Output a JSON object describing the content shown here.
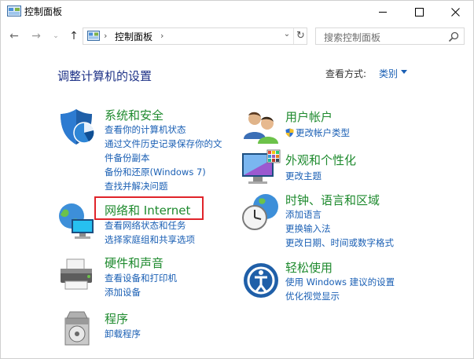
{
  "window": {
    "title": "控制面板"
  },
  "nav": {
    "back": "←",
    "forward": "→",
    "recent": "⌄",
    "up": "↑",
    "address": "控制面板",
    "address_sep": "›",
    "dropdown": "⌄",
    "refresh": "↻"
  },
  "search": {
    "placeholder": "搜索控制面板"
  },
  "header": {
    "title": "调整计算机的设置",
    "view_by_label": "查看方式:",
    "view_by_value": "类别"
  },
  "categories": {
    "system": {
      "title": "系统和安全",
      "links": [
        "查看你的计算机状态",
        "通过文件历史记录保存你的文",
        "件备份副本",
        "备份和还原(Windows 7)",
        "查找并解决问题"
      ]
    },
    "network": {
      "title": "网络和 Internet",
      "links": [
        "查看网络状态和任务",
        "选择家庭组和共享选项"
      ]
    },
    "hardware": {
      "title": "硬件和声音",
      "links": [
        "查看设备和打印机",
        "添加设备"
      ]
    },
    "programs": {
      "title": "程序",
      "links": [
        "卸载程序"
      ]
    },
    "users": {
      "title": "用户帐户",
      "links": [
        "更改帐户类型"
      ]
    },
    "appearance": {
      "title": "外观和个性化",
      "links": [
        "更改主题"
      ]
    },
    "clock": {
      "title": "时钟、语言和区域",
      "links": [
        "添加语言",
        "更换输入法",
        "更改日期、时间或数字格式"
      ]
    },
    "ease": {
      "title": "轻松使用",
      "links": [
        "使用 Windows 建议的设置",
        "优化视觉显示"
      ]
    }
  },
  "colors": {
    "title_blue": "#1e3287",
    "category_green": "#1e8a2e",
    "link_blue": "#1a5fb4",
    "highlight_red": "#e0242a"
  }
}
